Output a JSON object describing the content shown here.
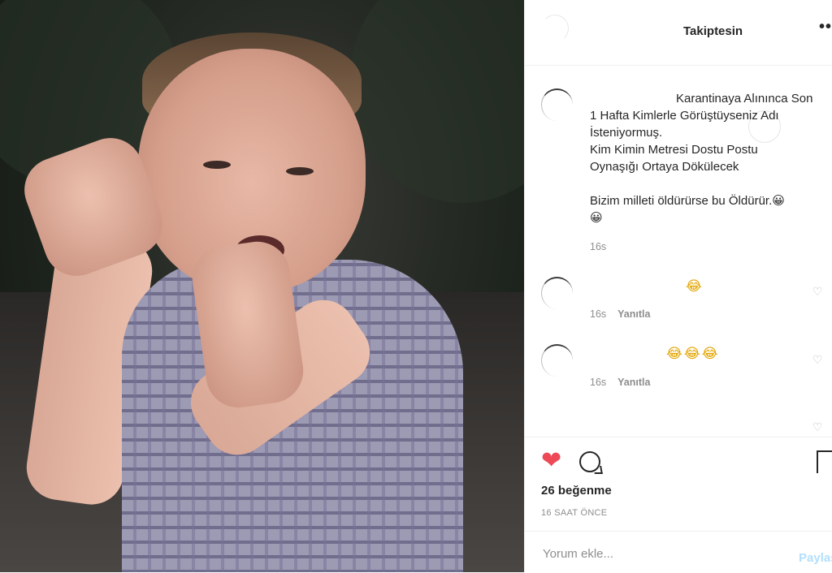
{
  "header": {
    "follow_status": "Takiptesin",
    "more_icon": "••"
  },
  "caption": {
    "line1": "Karantinaya Alınınca Son",
    "line2": "1 Hafta Kimlerle Görüştüyseniz Adı",
    "line3": "İsteniyormuş.",
    "line4": "Kim Kimin Metresi Dostu Postu",
    "line5": "Oynaşığı Ortaya Dökülecek",
    "line6": "Bizim milleti öldürürse bu Öldürür.😀",
    "line7": "😀",
    "time": "16s"
  },
  "comments": [
    {
      "text": "😂",
      "time": "16s",
      "reply": "Yanıtla"
    },
    {
      "text": "😂😂😂",
      "time": "16s",
      "reply": "Yanıtla"
    }
  ],
  "actions": {
    "likes": "26 beğenme",
    "posted": "16 SAAT ÖNCE"
  },
  "add_comment": {
    "placeholder": "Yorum ekle...",
    "post_label": "Paylaş"
  },
  "colors": {
    "like_red": "#ed4956",
    "post_blue": "#b2dffc",
    "meta_gray": "#8e8e8e"
  }
}
